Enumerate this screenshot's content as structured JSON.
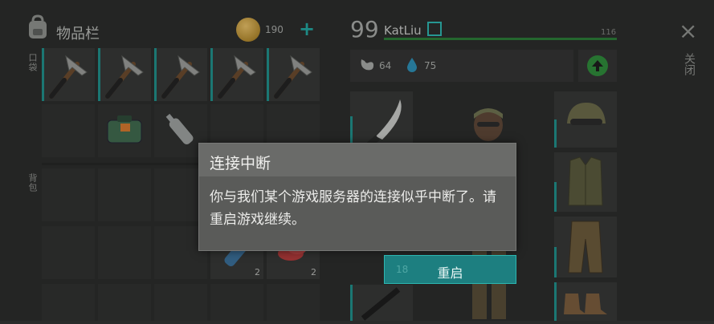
{
  "inventory": {
    "title": "物品栏",
    "pocket_label": "口袋",
    "backpack_label": "背包",
    "coins": "190",
    "add_symbol": "+"
  },
  "player": {
    "level": "99",
    "name": "KatLiu",
    "xp_max": "116",
    "food": "64",
    "water": "75"
  },
  "close": {
    "icon": "×",
    "label": "关闭"
  },
  "slots": {
    "backpack_counts": [
      "2",
      "2"
    ],
    "weapon_slot_count": "18"
  },
  "dialog": {
    "title": "连接中断",
    "message": "你与我们某个游戏服务器的连接似乎中断了。请重启游戏继续。",
    "button": "重启"
  },
  "colors": {
    "accent": "#2cb6b0",
    "xp_bar": "#2a7c36",
    "durability": "#1f8f8a"
  },
  "icons": [
    "backpack-icon",
    "coin-icon",
    "plus-icon",
    "edit-icon",
    "stomach-icon",
    "water-drop-icon",
    "level-up-icon",
    "close-icon",
    "hammer-icon",
    "medkit-icon",
    "bottle-icon",
    "machete-icon",
    "helmet-icon",
    "vest-icon",
    "pants-icon",
    "boots-icon",
    "rifle-icon"
  ]
}
